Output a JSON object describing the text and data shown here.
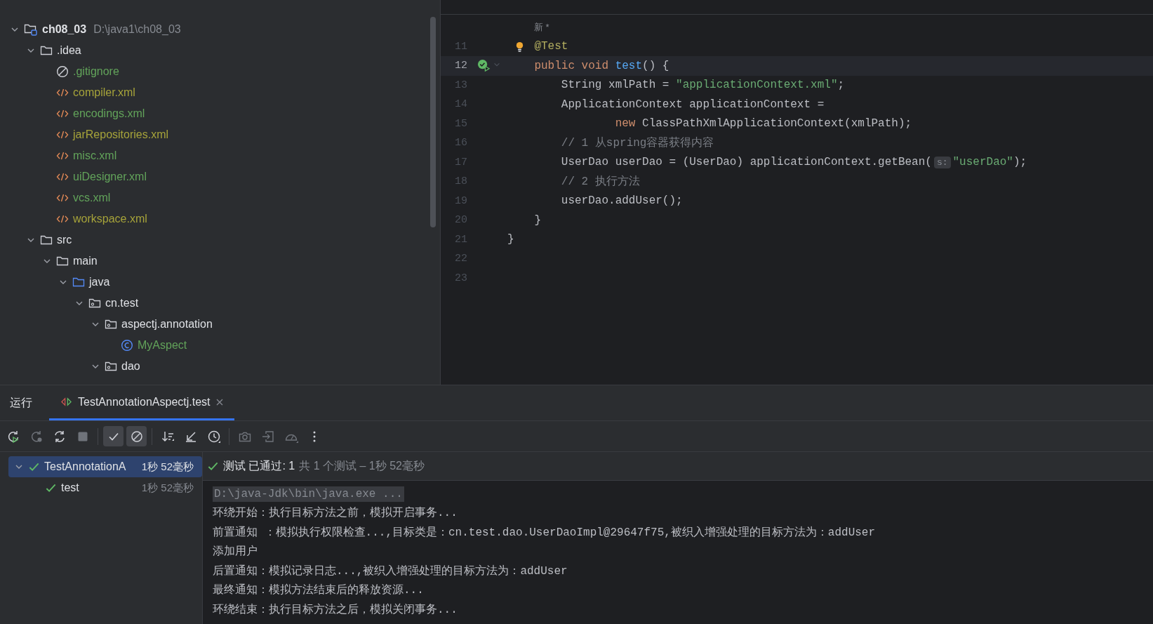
{
  "project_tree": [
    {
      "kind": "project",
      "name": "ch08_03",
      "path": "D:\\java1\\ch08_03",
      "expanded": true,
      "children": [
        {
          "kind": "folder",
          "name": ".idea",
          "expanded": true,
          "children": [
            {
              "kind": "ignore",
              "name": ".gitignore",
              "color": "#62a35a"
            },
            {
              "kind": "xml",
              "name": "compiler.xml",
              "color": "#a6a33a"
            },
            {
              "kind": "xml",
              "name": "encodings.xml",
              "color": "#62a35a"
            },
            {
              "kind": "xml",
              "name": "jarRepositories.xml",
              "color": "#a6a33a"
            },
            {
              "kind": "xml",
              "name": "misc.xml",
              "color": "#62a35a"
            },
            {
              "kind": "xml",
              "name": "uiDesigner.xml",
              "color": "#62a35a"
            },
            {
              "kind": "xml",
              "name": "vcs.xml",
              "color": "#62a35a"
            },
            {
              "kind": "xml",
              "name": "workspace.xml",
              "color": "#a6a33a"
            }
          ]
        },
        {
          "kind": "folder",
          "name": "src",
          "expanded": true,
          "children": [
            {
              "kind": "folder",
              "name": "main",
              "expanded": true,
              "children": [
                {
                  "kind": "source",
                  "name": "java",
                  "expanded": true,
                  "children": [
                    {
                      "kind": "package",
                      "name": "cn.test",
                      "expanded": true,
                      "children": [
                        {
                          "kind": "package",
                          "name": "aspectj.annotation",
                          "expanded": true,
                          "children": [
                            {
                              "kind": "class",
                              "name": "MyAspect",
                              "color": "#62a35a"
                            }
                          ]
                        },
                        {
                          "kind": "package",
                          "name": "dao",
                          "expanded": true
                        }
                      ]
                    }
                  ]
                }
              ]
            }
          ]
        }
      ]
    }
  ],
  "editor": {
    "code_vision": "新 *",
    "lines": [
      {
        "number": "11",
        "gutter_icon": {
          "kind": "bulb"
        },
        "current": false,
        "tokens": [
          {
            "kind": "annotation",
            "text": "    @Test"
          }
        ]
      },
      {
        "number": "12",
        "gutter_icon": {
          "kind": "run-passed"
        },
        "foldable": true,
        "current": true,
        "tokens": [
          {
            "kind": "keyword",
            "text": "    public void "
          },
          {
            "kind": "method",
            "text": "test"
          },
          {
            "kind": "plain",
            "text": "() {"
          }
        ]
      },
      {
        "number": "13",
        "current": false,
        "tokens": [
          {
            "kind": "plain",
            "text": "        String xmlPath = "
          },
          {
            "kind": "string",
            "text": "\"applicationContext.xml\""
          },
          {
            "kind": "plain",
            "text": ";"
          }
        ]
      },
      {
        "number": "14",
        "current": false,
        "tokens": [
          {
            "kind": "plain",
            "text": "        ApplicationContext applicationContext ="
          }
        ]
      },
      {
        "number": "15",
        "current": false,
        "tokens": [
          {
            "kind": "keyword",
            "text": "                new "
          },
          {
            "kind": "plain",
            "text": "ClassPathXmlApplicationContext(xmlPath);"
          }
        ]
      },
      {
        "number": "16",
        "current": false,
        "tokens": [
          {
            "kind": "comment",
            "text": "        // 1 从spring容器获得内容"
          }
        ]
      },
      {
        "number": "17",
        "current": false,
        "tokens": [
          {
            "kind": "plain",
            "text": "        UserDao userDao = (UserDao) applicationContext.getBean("
          },
          {
            "kind": "hint",
            "text": "s:"
          },
          {
            "kind": "string",
            "text": "\"userDao\""
          },
          {
            "kind": "plain",
            "text": ");"
          }
        ]
      },
      {
        "number": "18",
        "current": false,
        "tokens": [
          {
            "kind": "comment",
            "text": "        // 2 执行方法"
          }
        ]
      },
      {
        "number": "19",
        "current": false,
        "tokens": [
          {
            "kind": "plain",
            "text": "        userDao.addUser();"
          }
        ]
      },
      {
        "number": "20",
        "current": false,
        "tokens": [
          {
            "kind": "plain",
            "text": "    }"
          }
        ]
      },
      {
        "number": "21",
        "current": false,
        "tokens": [
          {
            "kind": "plain",
            "text": "}"
          }
        ]
      },
      {
        "number": "22",
        "current": false
      },
      {
        "number": "23",
        "current": false
      }
    ]
  },
  "run_panel": {
    "title": "运行",
    "tabs": [
      {
        "label": "TestAnnotationAspectj.test",
        "selected": true
      }
    ],
    "toolbar": [
      {
        "kind": "rerun",
        "disabled": false,
        "on": false
      },
      {
        "kind": "rerun-failed",
        "disabled": true,
        "on": false
      },
      {
        "kind": "toggle-auto",
        "disabled": false,
        "on": false
      },
      {
        "kind": "stop",
        "disabled": true,
        "on": false
      },
      {
        "kind": "sep"
      },
      {
        "kind": "show-passed",
        "disabled": false,
        "on": true
      },
      {
        "kind": "show-ignored",
        "disabled": false,
        "on": true
      },
      {
        "kind": "sep"
      },
      {
        "kind": "sort",
        "disabled": false,
        "on": false
      },
      {
        "kind": "import-tests",
        "disabled": false,
        "on": false
      },
      {
        "kind": "history",
        "disabled": false,
        "on": false
      },
      {
        "kind": "sep"
      },
      {
        "kind": "camera",
        "disabled": true,
        "on": false
      },
      {
        "kind": "export",
        "disabled": true,
        "on": false
      },
      {
        "kind": "gauge",
        "disabled": true,
        "on": false
      },
      {
        "kind": "more",
        "disabled": false,
        "on": false
      }
    ],
    "tests": [
      {
        "name": "TestAnnotationA",
        "time": "1秒 52毫秒",
        "selected": true,
        "expanded": true,
        "children": [
          {
            "name": "test",
            "time": "1秒 52毫秒",
            "selected": false
          }
        ]
      }
    ],
    "status": {
      "label": "测试 已通过: 1",
      "detail": "共 1 个测试 – 1秒 52毫秒"
    },
    "console": [
      {
        "kind": "command",
        "text": "D:\\java-Jdk\\bin\\java.exe ..."
      },
      {
        "kind": "output",
        "text": "环绕开始：执行目标方法之前，模拟开启事务..."
      },
      {
        "kind": "output",
        "text": "前置通知 ：模拟执行权限检查...,目标类是：cn.test.dao.UserDaoImpl@29647f75,被织入增强处理的目标方法为：addUser"
      },
      {
        "kind": "output",
        "text": "添加用户"
      },
      {
        "kind": "output",
        "text": "后置通知：模拟记录日志...,被织入增强处理的目标方法为：addUser"
      },
      {
        "kind": "output",
        "text": "最终通知：模拟方法结束后的释放资源..."
      },
      {
        "kind": "output",
        "text": "环绕结束：执行目标方法之后，模拟关闭事务..."
      }
    ]
  }
}
